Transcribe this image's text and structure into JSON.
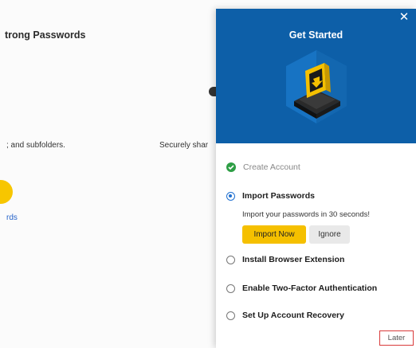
{
  "background": {
    "title": "trong Passwords",
    "text_left": "; and subfolders.",
    "text_mid": "Securely shar",
    "link": "rds"
  },
  "panel": {
    "title": "Get Started",
    "close_icon": "close-icon",
    "steps": [
      {
        "label": "Create Account",
        "state": "completed"
      },
      {
        "label": "Import Passwords",
        "state": "active"
      },
      {
        "label": "Install Browser Extension",
        "state": "pending"
      },
      {
        "label": "Enable Two-Factor Authentication",
        "state": "pending"
      },
      {
        "label": "Set Up Account Recovery",
        "state": "pending"
      }
    ],
    "import_description": "Import your passwords in 30 seconds!",
    "import_now_label": "Import Now",
    "ignore_label": "Ignore",
    "later_label": "Later",
    "colors": {
      "hero_bg": "#0d5fa8",
      "accent_yellow": "#f5c000",
      "check_green": "#2e9e45",
      "radio_blue": "#1e6fd0",
      "later_border": "#d93a3a"
    }
  }
}
